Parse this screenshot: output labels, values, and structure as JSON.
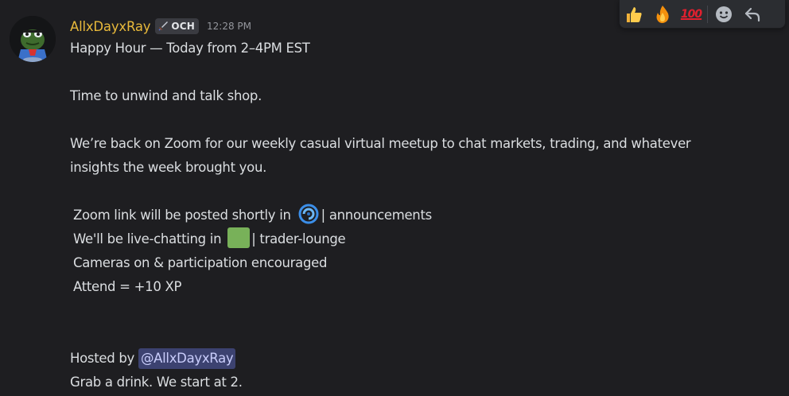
{
  "message": {
    "author": {
      "username": "AllxDayxRay",
      "username_color": "#e8b93b",
      "tag": "OCH",
      "tag_icon": "sword-icon",
      "avatar_icon": "frog-avatar-icon"
    },
    "timestamp": "12:28 PM",
    "lines": {
      "l1": "Happy Hour — Today from 2–4PM EST",
      "l2": "Time to unwind and talk shop.",
      "l3": "We’re back on Zoom for our weekly casual virtual meetup to chat markets, trading, and whatever",
      "l4": "insights the week brought you.",
      "l5_prefix": "Zoom link will be posted shortly in",
      "l5_channel": "announcements",
      "l6_prefix": "We'll be live-chatting in",
      "l6_channel": "trader-lounge",
      "l7": "Cameras on & participation encouraged",
      "l8": "Attend = +10 XP",
      "l9_prefix": "Hosted by",
      "l9_mention": "@AllxDayxRay",
      "l10": "Grab a drink. We start at 2."
    },
    "channel_separator": "|",
    "announcements_icon": "blue-cyclone-icon",
    "trader_lounge_icon": "green-square-icon"
  },
  "toolbar": {
    "reactions": [
      {
        "icon": "thumbs-up-icon"
      },
      {
        "icon": "fire-icon"
      },
      {
        "icon": "hundred-points-icon",
        "label": "100"
      }
    ],
    "add_reaction_icon": "add-reaction-icon",
    "reply_icon": "reply-icon"
  },
  "colors": {
    "background": "#1e1e21",
    "text": "#dbdee1",
    "mention_bg": "#3c4270",
    "mention_text": "#c9cdfb",
    "timestamp": "#94969c"
  }
}
